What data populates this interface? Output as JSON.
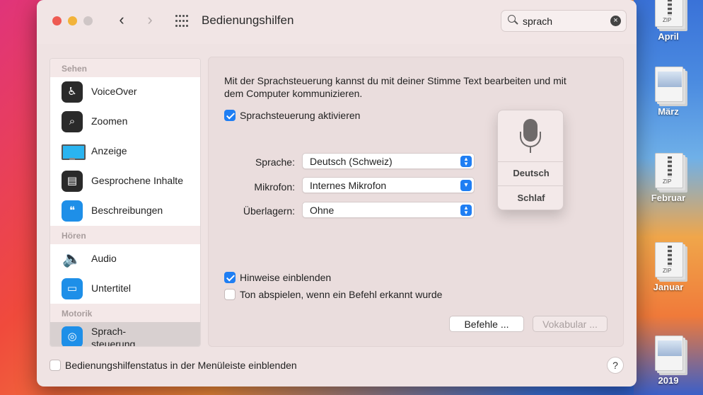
{
  "window": {
    "title": "Bedienungshilfen",
    "search": {
      "value": "sprach"
    }
  },
  "sidebar": {
    "sections": [
      {
        "label": "Sehen"
      },
      {
        "label": "Hören"
      },
      {
        "label": "Motorik"
      }
    ],
    "items": [
      {
        "label": "VoiceOver",
        "icon": "voiceover-icon"
      },
      {
        "label": "Zoomen",
        "icon": "zoom-icon"
      },
      {
        "label": "Anzeige",
        "icon": "display-icon"
      },
      {
        "label": "Gesprochene Inhalte",
        "icon": "spoken-content-icon"
      },
      {
        "label": "Beschreibungen",
        "icon": "descriptions-icon"
      },
      {
        "label": "Audio",
        "icon": "speaker-icon"
      },
      {
        "label": "Untertitel",
        "icon": "captions-icon"
      },
      {
        "label_line1": "Sprach-",
        "label_line2": "steuerung",
        "icon": "voice-control-icon",
        "selected": true
      }
    ]
  },
  "pane": {
    "intro_line1": "Mit der Sprachsteuerung kannst du mit deiner Stimme Text bearbeiten und mit",
    "intro_line2": "dem Computer kommunizieren.",
    "enable_label": "Sprachsteuerung aktivieren",
    "enable_checked": true,
    "language_label": "Sprache:",
    "language_value": "Deutsch (Schweiz)",
    "mic_label": "Mikrofon:",
    "mic_value": "Internes Mikrofon",
    "overlay_label": "Überlagern:",
    "overlay_value": "Ohne",
    "mic_widget": {
      "language": "Deutsch",
      "state": "Schlaf"
    },
    "hints_label": "Hinweise einblenden",
    "hints_checked": true,
    "sound_label": "Ton abspielen, wenn ein Befehl erkannt wurde",
    "sound_checked": false,
    "commands_button": "Befehle ...",
    "vocabulary_button": "Vokabular ..."
  },
  "footer": {
    "menubar_label": "Bedienungshilfenstatus in der Menüleiste einblenden",
    "menubar_checked": false,
    "help": "?"
  },
  "desktop": {
    "items": [
      {
        "label": "April",
        "icon": "document-stack-icon"
      },
      {
        "label": "März",
        "icon": "document-stack-icon"
      },
      {
        "label": "Februar",
        "icon": "zip-archive-icon",
        "badge": "ZIP"
      },
      {
        "label": "Januar",
        "icon": "zip-archive-icon",
        "badge": "ZIP"
      },
      {
        "label": "2019",
        "icon": "document-stack-icon"
      }
    ],
    "zip_badge": "ZIP"
  },
  "colors": {
    "accent": "#1f7ef3",
    "close": "#ee5a52",
    "minimize": "#f2b33a"
  }
}
